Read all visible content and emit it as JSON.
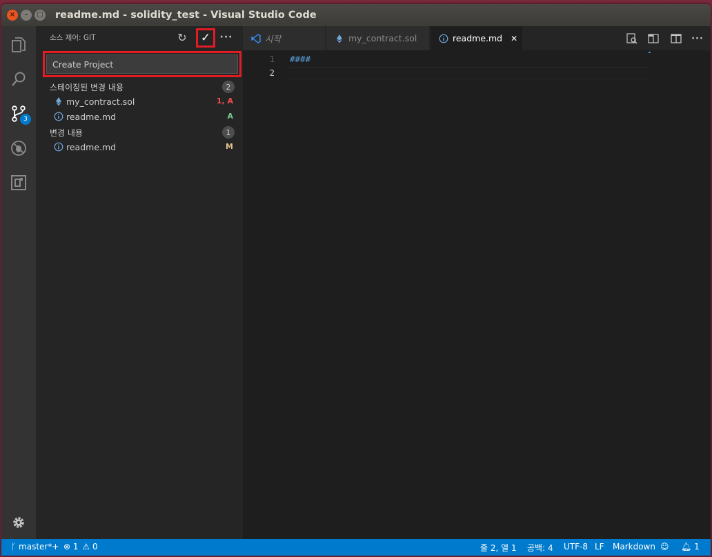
{
  "window": {
    "title": "readme.md - solidity_test - Visual Studio Code",
    "close_glyph": "×",
    "min_glyph": "–",
    "max_glyph": "□"
  },
  "activity_bar": {
    "items": [
      "files-icon",
      "search-icon",
      "source-control-icon",
      "debug-icon",
      "extensions-icon"
    ],
    "scm_badge": "3",
    "settings_icon": "gear-icon"
  },
  "sidebar": {
    "title": "소스 제어: GIT",
    "actions": {
      "refresh": "↻",
      "commit": "✓",
      "more": "···"
    },
    "commit_message": "Create Project",
    "staged": {
      "label": "스테이징된 변경 내용",
      "count": "2",
      "files": [
        {
          "name": "my_contract.sol",
          "icon": "ethereum-icon",
          "status": "1, A",
          "status_color": "#f14c4c"
        },
        {
          "name": "readme.md",
          "icon": "info-icon",
          "status": "A",
          "status_color": "#73c991"
        }
      ]
    },
    "changes": {
      "label": "변경 내용",
      "count": "1",
      "files": [
        {
          "name": "readme.md",
          "icon": "info-icon",
          "status": "M",
          "status_color": "#e2c08d"
        }
      ]
    }
  },
  "editor": {
    "tabs": [
      {
        "label": "시작",
        "icon": "vscode-icon",
        "active": false
      },
      {
        "label": "my_contract.sol",
        "icon": "ethereum-icon",
        "active": false
      },
      {
        "label": "readme.md",
        "icon": "info-icon",
        "active": true,
        "close": "✕"
      }
    ],
    "actions": [
      "open-preview-icon",
      "preview-side-icon",
      "split-editor-icon",
      "more-icon"
    ],
    "more_glyph": "···",
    "lines": [
      {
        "number": "1",
        "text": "####",
        "color": "#569cd6"
      },
      {
        "number": "2",
        "text": "",
        "color": "#d4d4d4"
      }
    ]
  },
  "status_bar": {
    "branch": "master*+",
    "errors": "1",
    "warnings": "0",
    "position": "줄 2, 열 1",
    "indent": "공백: 4",
    "encoding": "UTF-8",
    "eol": "LF",
    "language": "Markdown",
    "notifications": "1",
    "background": "#007acc"
  }
}
